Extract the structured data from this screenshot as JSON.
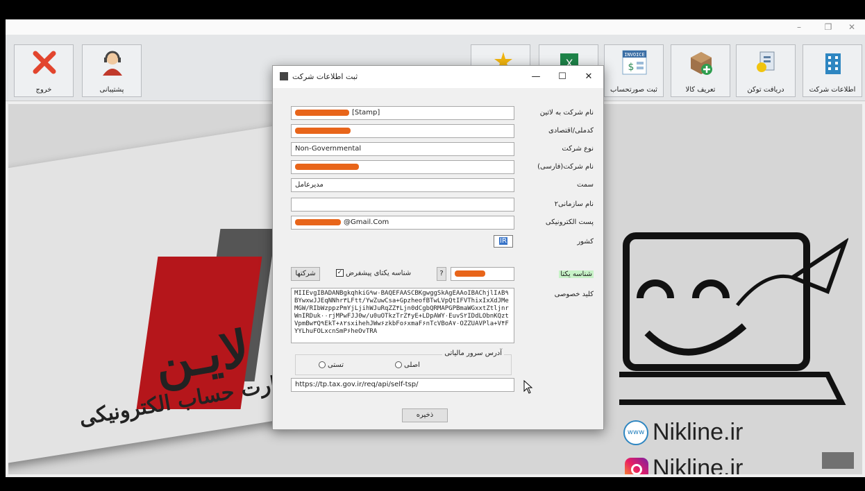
{
  "window": {
    "minimize": "–",
    "restore": "❐",
    "close": "✕"
  },
  "toolbar": {
    "company_info": "اطلاعات شرکت",
    "get_token": "دریافت توکن",
    "define_goods": "تعریف کالا",
    "register_invoice": "ثبت صورتحساب",
    "support": "پشتیبانی",
    "exit": "خروج",
    "invoice_badge": "INVOICE"
  },
  "dialog": {
    "title": "ثبت اطلاعات شرکت",
    "minimize": "—",
    "maximize": "☐",
    "close": "✕",
    "labels": {
      "company_latin": "نام شرکت به لاتین",
      "national_code": "کدملی/اقتصادی",
      "company_type": "نوع شرکت",
      "company_persian": "نام شرکت(فارسی)",
      "position": "سمت",
      "org_name2": "نام سازمانی۲",
      "email": "پست الکترونیکی",
      "country": "کشور",
      "unique_id": "شناسه یکتا",
      "private_key": "کلید خصوصی",
      "default_unique_id": "شناسه یکتای پیشفرض",
      "tax_server": "آدرس سرور مالیاتی",
      "main": "اصلی",
      "test": "تستی"
    },
    "values": {
      "company_latin": "[Stamp]",
      "company_type": "Non-Governmental",
      "position": "مدیرعامل",
      "org_name2": "",
      "email": "@Gmail.Com",
      "country": "IR",
      "private_key": "MIIEvgIBADANBgkqhkiG۹w۰BAQEFAASCBKgwggSkAgEAAoIBAChjlI۸B۹BYwxwJJEqNNhr۳LFtt/YwZuwCsa+GpzheofBTwLVpQtIFVThixIxXdJMeMGW/RIbWzppzPmYjLjihWJuRqZZ۴Ljn0dCgbQRMAPGPBmaWGxxtZtljnrWnIRDuk۰۰rjMPwFJJ0w/u0uOTkzTrZ۴yE+LDpAWY۰EuvS۲IDdLObnKQztVpmBw۳Q۹EkT+۸۲sxihehJWw۶zkbFo۶xmaF۶nTcVBoA۷۰OZZUAVPla+V۴FYYLhuFOLxcnSmP۶heOvTRA",
      "tax_server_url": "https://tp.tax.gov.ir/req/api/self-tsp/"
    },
    "buttons": {
      "companies": "شرکتها",
      "help": "?",
      "save": "ذخیره"
    }
  },
  "background": {
    "brand_line1": "لایـن",
    "brand_line2": "کارت حساب الکترونیکی",
    "site1": "Nikline.ir",
    "site2": "Nikline.ir",
    "www": "www"
  }
}
